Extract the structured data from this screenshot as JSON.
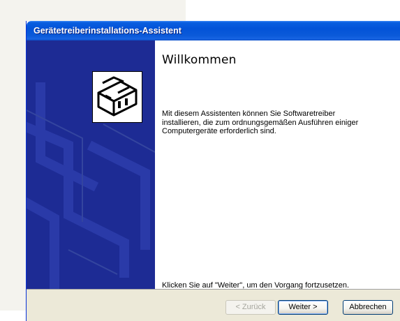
{
  "window": {
    "title": "Gerätetreiberinstallations-Assistent"
  },
  "sidebar": {
    "icon": "driver-install-icon"
  },
  "main": {
    "heading": "Willkommen",
    "intro": "Mit diesem Assistenten können Sie Softwaretreiber installieren, die zum ordnungsgemäßen Ausführen einiger Computergeräte erforderlich sind.",
    "next_hint": "Klicken Sie auf \"Weiter\", um den Vorgang fortzusetzen."
  },
  "footer": {
    "back_label": "< Zurück",
    "next_label": "Weiter >",
    "cancel_label": "Abbrechen"
  },
  "colors": {
    "titlebar": "#0353d8",
    "sidebar": "#1d2b94",
    "footer": "#ece9d8"
  }
}
